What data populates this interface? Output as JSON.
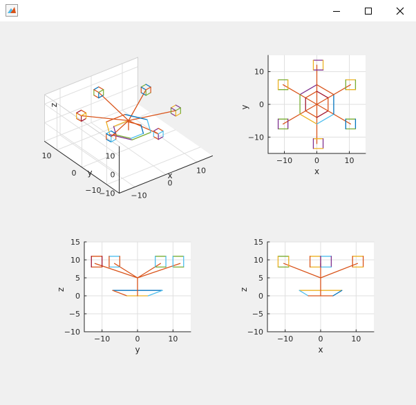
{
  "window": {
    "minimize_icon": "minimize-icon",
    "maximize_icon": "maximize-icon",
    "close_icon": "close-icon",
    "app_icon": "matlab-figure-icon"
  },
  "colors": {
    "blue": "#0072bd",
    "orange": "#d95319",
    "yellow": "#edb120",
    "purple": "#7e2f8e",
    "green": "#77ac30",
    "cyan": "#4dbeee",
    "red": "#a2142f"
  },
  "chart_data": [
    {
      "type": "line3d",
      "view": "3d",
      "xlabel": "x",
      "ylabel": "y",
      "zlabel": "z",
      "xticks": [
        -10,
        0,
        10
      ],
      "yticks": [
        -10,
        0,
        10
      ],
      "zticks": [
        -10,
        0,
        10
      ],
      "xlim": [
        -15,
        15
      ],
      "ylim": [
        -15,
        15
      ],
      "zlim": [
        -10,
        15
      ],
      "grid": true
    },
    {
      "type": "line",
      "view": "top (x-y)",
      "xlabel": "x",
      "ylabel": "y",
      "xticks": [
        -10,
        0,
        10
      ],
      "yticks": [
        -10,
        0,
        10
      ],
      "xlim": [
        -15,
        15
      ],
      "ylim": [
        -15,
        15
      ],
      "grid": true,
      "hexagons": [
        {
          "radius": 6,
          "colors": [
            "#7e2f8e",
            "#77ac30",
            "#edb120",
            "#4dbeee",
            "#0072bd",
            "#d95319"
          ]
        },
        {
          "radius": 4,
          "colors": [
            "#d95319",
            "#a2142f",
            "#d95319",
            "#a2142f",
            "#d95319",
            "#a2142f"
          ]
        }
      ],
      "spokes_to": [
        [
          0,
          12
        ],
        [
          10.4,
          6
        ],
        [
          10.4,
          -6
        ],
        [
          0,
          -12
        ],
        [
          -10.4,
          -6
        ],
        [
          -10.4,
          6
        ]
      ],
      "boxes": [
        {
          "x": 0,
          "y": 12,
          "colors": [
            "#7e2f8e",
            "#edb120"
          ]
        },
        {
          "x": 10.4,
          "y": 6,
          "colors": [
            "#edb120",
            "#77ac30"
          ]
        },
        {
          "x": 10.4,
          "y": -6,
          "colors": [
            "#77ac30",
            "#0072bd"
          ]
        },
        {
          "x": 0,
          "y": -12,
          "colors": [
            "#edb120",
            "#7e2f8e"
          ]
        },
        {
          "x": -10.4,
          "y": -6,
          "colors": [
            "#77ac30",
            "#7e2f8e"
          ]
        },
        {
          "x": -10.4,
          "y": 6,
          "colors": [
            "#77ac30",
            "#edb120"
          ]
        }
      ]
    },
    {
      "type": "line",
      "view": "side (y-z)",
      "xlabel": "y",
      "ylabel": "z",
      "xticks": [
        -10,
        0,
        10
      ],
      "yticks": [
        -10,
        -5,
        0,
        5,
        10,
        15
      ],
      "xlim": [
        -15,
        15
      ],
      "ylim": [
        -10,
        15
      ],
      "grid": true,
      "stem": [
        [
          0,
          0
        ],
        [
          0,
          5
        ]
      ],
      "arms_to": [
        [
          -12,
          9
        ],
        [
          -6.5,
          9
        ],
        [
          6.5,
          9
        ],
        [
          12,
          9
        ]
      ],
      "boxes": [
        {
          "c": -11.5,
          "colors": [
            "#d95319",
            "#a2142f"
          ]
        },
        {
          "c": -6.5,
          "colors": [
            "#4dbeee",
            "#d95319"
          ]
        },
        {
          "c": 6.5,
          "colors": [
            "#77ac30",
            "#4dbeee"
          ]
        },
        {
          "c": 11.5,
          "colors": [
            "#77ac30",
            "#4dbeee"
          ]
        }
      ],
      "base": {
        "top": [
          [
            -7,
            1.5
          ],
          [
            7,
            1.5
          ]
        ],
        "bottom": [
          [
            -3,
            0
          ],
          [
            3,
            0
          ]
        ],
        "colors": [
          "#0072bd",
          "#d95319",
          "#edb120",
          "#4dbeee"
        ]
      }
    },
    {
      "type": "line",
      "view": "side (x-z)",
      "xlabel": "x",
      "ylabel": "z",
      "xticks": [
        -10,
        0,
        10
      ],
      "yticks": [
        -10,
        -5,
        0,
        5,
        10,
        15
      ],
      "xlim": [
        -15,
        15
      ],
      "ylim": [
        -10,
        15
      ],
      "grid": true,
      "stem": [
        [
          0,
          0
        ],
        [
          0,
          5
        ]
      ],
      "arms_to": [
        [
          -10.4,
          9
        ],
        [
          0,
          9
        ],
        [
          10.4,
          9
        ]
      ],
      "boxes": [
        {
          "c": -10.5,
          "colors": [
            "#77ac30",
            "#edb120"
          ]
        },
        {
          "c": -1.5,
          "colors": [
            "#edb120",
            "#d95319"
          ]
        },
        {
          "c": 1.5,
          "colors": [
            "#4dbeee",
            "#7e2f8e"
          ]
        },
        {
          "c": 10.5,
          "colors": [
            "#edb120",
            "#d95319"
          ]
        }
      ],
      "base": {
        "top": [
          [
            -6,
            1.5
          ],
          [
            6,
            1.5
          ]
        ],
        "bottom": [
          [
            -3.5,
            0
          ],
          [
            3.5,
            0
          ]
        ],
        "colors": [
          "#edb120",
          "#4dbeee",
          "#d95319",
          "#0072bd"
        ]
      }
    }
  ]
}
